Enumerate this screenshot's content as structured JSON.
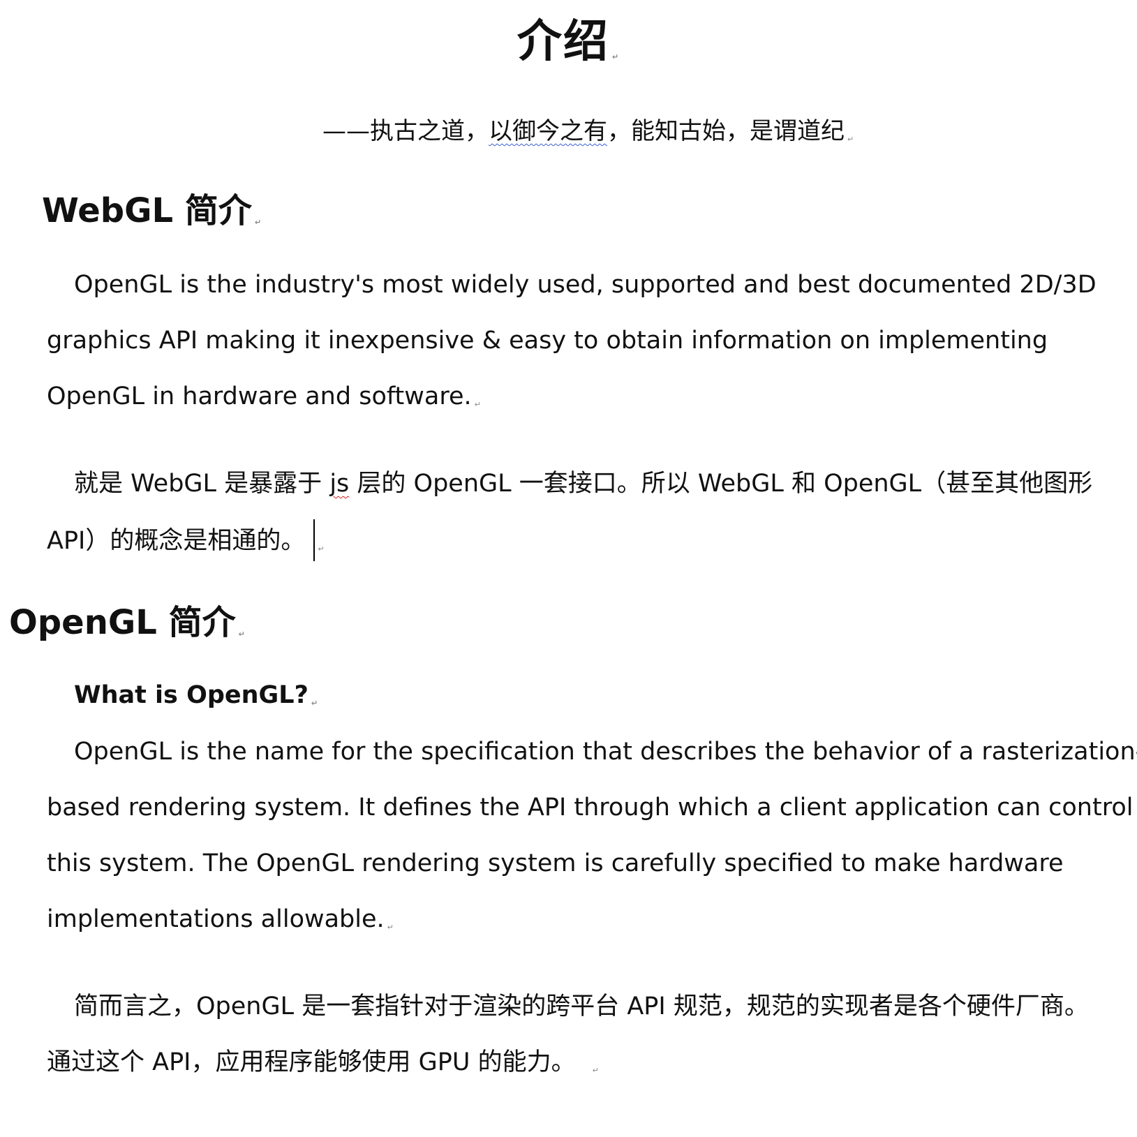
{
  "page_title": "介绍",
  "epigraph": {
    "prefix": "——执古之道，",
    "flagged": "以御今之有",
    "suffix": "，能知古始，是谓道纪"
  },
  "webgl_section": {
    "heading": "WebGL 简介",
    "para1_lines": [
      "OpenGL is the industry's most widely used, supported and best documented 2D/3D",
      "graphics API making it inexpensive & easy to obtain information on implementing",
      "OpenGL in hardware and software."
    ],
    "para2_line1_a": "就是 WebGL 是暴露于 ",
    "para2_line1_flagged": "js",
    "para2_line1_b": " 层的 OpenGL 一套接口。所以 WebGL 和 OpenGL（甚至其他图形",
    "para2_line2": "API）的概念是相通的。"
  },
  "opengl_section": {
    "heading": "OpenGL 简介",
    "subheading": "What is OpenGL?",
    "para1_lines": [
      "OpenGL is the name for the specification that describes the behavior of a rasterization-",
      "based rendering system. It defines the API through which a client application can control",
      "this system. The OpenGL rendering system is carefully specified to make hardware",
      "implementations allowable."
    ],
    "para2_lines": [
      "简而言之，OpenGL 是一套指针对于渲染的跨平台 API 规范，规范的实现者是各个硬件厂商。",
      "通过这个 API，应用程序能够使用 GPU 的能力。"
    ]
  },
  "paragraph_mark": "↵"
}
